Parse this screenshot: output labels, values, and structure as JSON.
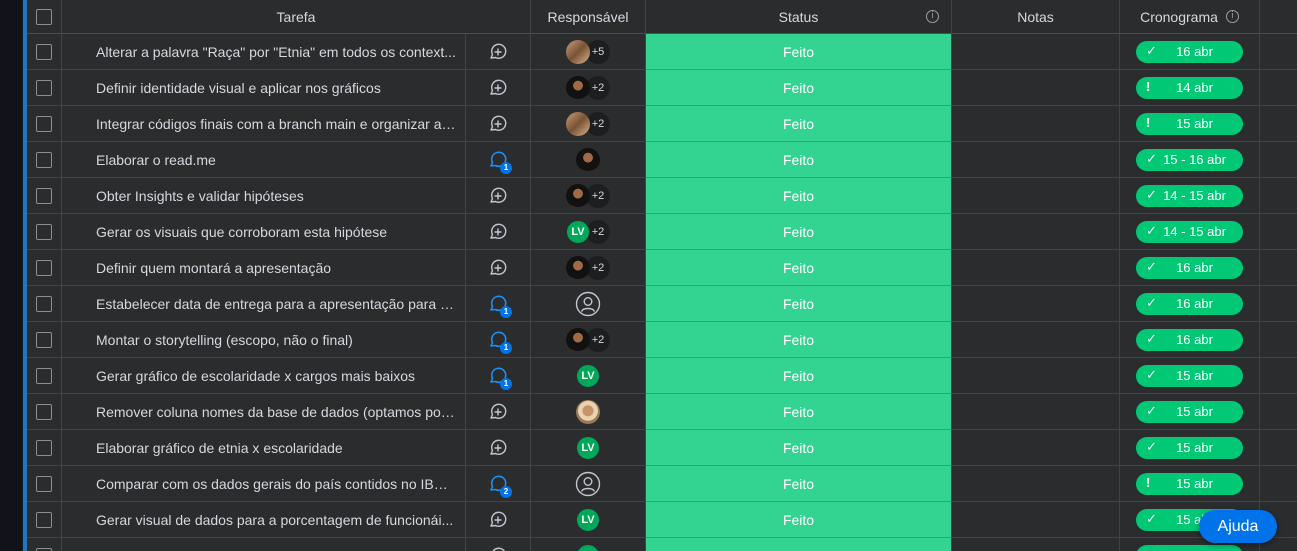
{
  "header": {
    "task": "Tarefa",
    "responsible": "Responsável",
    "status": "Status",
    "notes": "Notas",
    "timeline": "Cronograma"
  },
  "rows": [
    {
      "task": "Alterar a palavra \"Raça\" por \"Etnia\" em todos os context...",
      "update_badge": "",
      "avatar": "photo3",
      "extra": "+5",
      "status": "Feito",
      "timeline": "16 abr",
      "timeline_mark": "check"
    },
    {
      "task": "Definir identidade visual e aplicar nos gráficos",
      "update_badge": "",
      "avatar": "photo2",
      "extra": "+2",
      "status": "Feito",
      "timeline": "14 abr",
      "timeline_mark": "exclaim"
    },
    {
      "task": "Integrar códigos finais com a branch main e organizar a ...",
      "update_badge": "",
      "avatar": "photo3",
      "extra": "+2",
      "status": "Feito",
      "timeline": "15 abr",
      "timeline_mark": "exclaim"
    },
    {
      "task": "Elaborar o read.me",
      "update_badge": "1",
      "avatar": "photo2",
      "extra": "",
      "status": "Feito",
      "timeline": "15 - 16 abr",
      "timeline_mark": "check"
    },
    {
      "task": "Obter Insights e validar hipóteses",
      "update_badge": "",
      "avatar": "photo2",
      "extra": "+2",
      "status": "Feito",
      "timeline": "14 - 15 abr",
      "timeline_mark": "check"
    },
    {
      "task": "Gerar os visuais que corroboram esta hipótese",
      "update_badge": "",
      "avatar": "lv",
      "avatar_text": "LV",
      "extra": "+2",
      "status": "Feito",
      "timeline": "14 - 15 abr",
      "timeline_mark": "check"
    },
    {
      "task": "Definir quem montará a apresentação",
      "update_badge": "",
      "avatar": "photo2",
      "extra": "+2",
      "status": "Feito",
      "timeline": "16 abr",
      "timeline_mark": "check"
    },
    {
      "task": "Estabelecer data de entrega para a apresentação para o...",
      "update_badge": "1",
      "avatar": "empty",
      "extra": "",
      "status": "Feito",
      "timeline": "16 abr",
      "timeline_mark": "check"
    },
    {
      "task": "Montar o storytelling (escopo, não o final)",
      "update_badge": "1",
      "avatar": "photo2",
      "extra": "+2",
      "status": "Feito",
      "timeline": "16 abr",
      "timeline_mark": "check"
    },
    {
      "task": "Gerar gráfico de escolaridade x cargos mais baixos",
      "update_badge": "1",
      "avatar": "lv",
      "avatar_text": "LV",
      "extra": "",
      "status": "Feito",
      "timeline": "15 abr",
      "timeline_mark": "check"
    },
    {
      "task": "Remover coluna nomes da base de dados (optamos por...",
      "update_badge": "",
      "avatar": "photo4",
      "extra": "",
      "status": "Feito",
      "timeline": "15 abr",
      "timeline_mark": "check"
    },
    {
      "task": "Elaborar gráfico de etnia x escolaridade",
      "update_badge": "",
      "avatar": "lv",
      "avatar_text": "LV",
      "extra": "",
      "status": "Feito",
      "timeline": "15 abr",
      "timeline_mark": "check"
    },
    {
      "task": "Comparar com os dados gerais do país contidos no IBG...",
      "update_badge": "2",
      "avatar": "empty",
      "extra": "",
      "status": "Feito",
      "timeline": "15 abr",
      "timeline_mark": "exclaim"
    },
    {
      "task": "Gerar visual de dados para a porcentagem de funcionái...",
      "update_badge": "",
      "avatar": "lv",
      "avatar_text": "LV",
      "extra": "",
      "status": "Feito",
      "timeline": "15 abr",
      "timeline_mark": "check"
    },
    {
      "task": "",
      "update_badge": "",
      "avatar": "lv",
      "avatar_text": "",
      "extra": "",
      "status": "",
      "timeline": "",
      "timeline_mark": "check"
    }
  ],
  "help_button": "Ajuda",
  "colors": {
    "status_done": "#33d391",
    "timeline_pill": "#00c875",
    "accent": "#1f76c2",
    "help": "#0073ea"
  }
}
